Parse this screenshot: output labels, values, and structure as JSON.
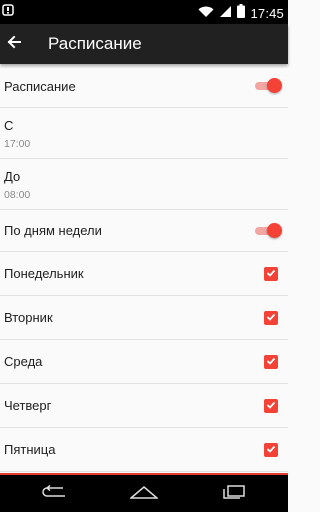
{
  "status_bar": {
    "time": "17:45",
    "icons": [
      "notification-icon",
      "wifi-icon",
      "signal-icon",
      "battery-icon"
    ]
  },
  "app_bar": {
    "back_icon": "arrow-back-icon",
    "title": "Расписание"
  },
  "settings": {
    "schedule": {
      "label": "Расписание",
      "enabled": true
    },
    "from": {
      "label": "С",
      "value": "17:00"
    },
    "to": {
      "label": "До",
      "value": "08:00"
    },
    "by_weekdays": {
      "label": "По дням недели",
      "enabled": true
    },
    "days": [
      {
        "label": "Понедельник",
        "checked": true
      },
      {
        "label": "Вторник",
        "checked": true
      },
      {
        "label": "Среда",
        "checked": true
      },
      {
        "label": "Четверг",
        "checked": true
      },
      {
        "label": "Пятница",
        "checked": true
      }
    ]
  },
  "nav_bar": {
    "icons": [
      "back-nav-icon",
      "home-nav-icon",
      "recents-nav-icon"
    ]
  },
  "colors": {
    "accent": "#f44336",
    "app_bar": "#212121",
    "background": "#fafafa"
  }
}
